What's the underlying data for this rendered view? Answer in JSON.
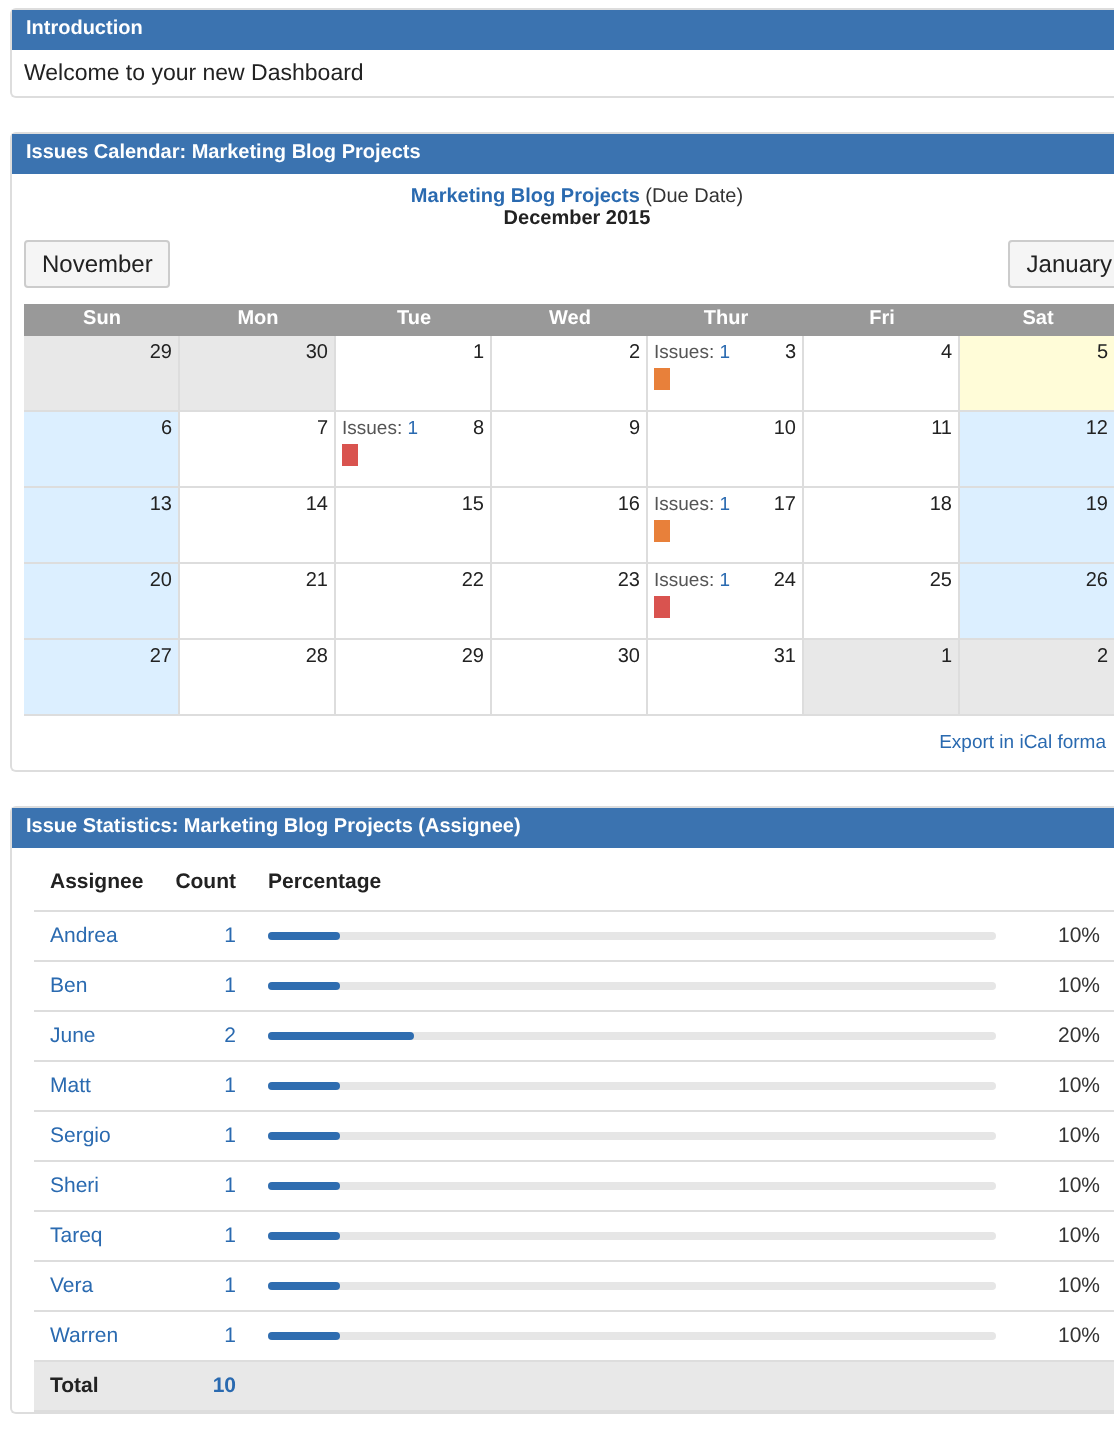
{
  "intro": {
    "title": "Introduction",
    "text": "Welcome to your new Dashboard"
  },
  "calendar": {
    "title": "Issues Calendar: Marketing Blog Projects",
    "filter_link": "Marketing Blog Projects",
    "filter_note": "(Due Date)",
    "month": "December 2015",
    "prev_button": "November",
    "next_button": "January",
    "weekdays": [
      "Sun",
      "Mon",
      "Tue",
      "Wed",
      "Thur",
      "Fri",
      "Sat"
    ],
    "weeks": [
      [
        {
          "day": "29",
          "kind": "other"
        },
        {
          "day": "30",
          "kind": "other"
        },
        {
          "day": "1",
          "kind": "normal"
        },
        {
          "day": "2",
          "kind": "normal"
        },
        {
          "day": "3",
          "kind": "normal",
          "issues": {
            "label": "Issues:",
            "count": "1",
            "color": "#e8803a"
          }
        },
        {
          "day": "4",
          "kind": "normal"
        },
        {
          "day": "5",
          "kind": "today"
        }
      ],
      [
        {
          "day": "6",
          "kind": "weekend"
        },
        {
          "day": "7",
          "kind": "normal"
        },
        {
          "day": "8",
          "kind": "normal",
          "issues": {
            "label": "Issues:",
            "count": "1",
            "color": "#d9534f"
          }
        },
        {
          "day": "9",
          "kind": "normal"
        },
        {
          "day": "10",
          "kind": "normal"
        },
        {
          "day": "11",
          "kind": "normal"
        },
        {
          "day": "12",
          "kind": "weekend"
        }
      ],
      [
        {
          "day": "13",
          "kind": "weekend"
        },
        {
          "day": "14",
          "kind": "normal"
        },
        {
          "day": "15",
          "kind": "normal"
        },
        {
          "day": "16",
          "kind": "normal"
        },
        {
          "day": "17",
          "kind": "normal",
          "issues": {
            "label": "Issues:",
            "count": "1",
            "color": "#e8803a"
          }
        },
        {
          "day": "18",
          "kind": "normal"
        },
        {
          "day": "19",
          "kind": "weekend"
        }
      ],
      [
        {
          "day": "20",
          "kind": "weekend"
        },
        {
          "day": "21",
          "kind": "normal"
        },
        {
          "day": "22",
          "kind": "normal"
        },
        {
          "day": "23",
          "kind": "normal"
        },
        {
          "day": "24",
          "kind": "normal",
          "issues": {
            "label": "Issues:",
            "count": "1",
            "color": "#d9534f"
          }
        },
        {
          "day": "25",
          "kind": "normal"
        },
        {
          "day": "26",
          "kind": "weekend"
        }
      ],
      [
        {
          "day": "27",
          "kind": "weekend"
        },
        {
          "day": "28",
          "kind": "normal"
        },
        {
          "day": "29",
          "kind": "normal"
        },
        {
          "day": "30",
          "kind": "normal"
        },
        {
          "day": "31",
          "kind": "normal"
        },
        {
          "day": "1",
          "kind": "other"
        },
        {
          "day": "2",
          "kind": "other"
        }
      ]
    ],
    "export_link": "Export in iCal forma"
  },
  "stats": {
    "title": "Issue Statistics: Marketing Blog Projects (Assignee)",
    "columns": [
      "Assignee",
      "Count",
      "Percentage"
    ],
    "rows": [
      {
        "assignee": "Andrea",
        "count": "1",
        "level": 0.1,
        "percent": "10%"
      },
      {
        "assignee": "Ben",
        "count": "1",
        "level": 0.1,
        "percent": "10%"
      },
      {
        "assignee": "June",
        "count": "2",
        "level": 0.2,
        "percent": "20%"
      },
      {
        "assignee": "Matt",
        "count": "1",
        "level": 0.1,
        "percent": "10%"
      },
      {
        "assignee": "Sergio",
        "count": "1",
        "level": 0.1,
        "percent": "10%"
      },
      {
        "assignee": "Sheri",
        "count": "1",
        "level": 0.1,
        "percent": "10%"
      },
      {
        "assignee": "Tareq",
        "count": "1",
        "level": 0.1,
        "percent": "10%"
      },
      {
        "assignee": "Vera",
        "count": "1",
        "level": 0.1,
        "percent": "10%"
      },
      {
        "assignee": "Warren",
        "count": "1",
        "level": 0.1,
        "percent": "10%"
      }
    ],
    "total": {
      "label": "Total",
      "count": "10"
    }
  }
}
